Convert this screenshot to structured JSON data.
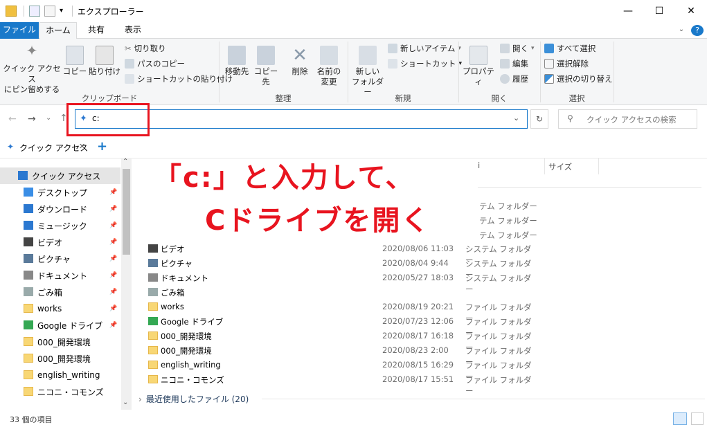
{
  "window": {
    "title": "エクスプローラー",
    "minimize": "—",
    "maximize": "☐",
    "close": "✕",
    "help": "?"
  },
  "tabs": {
    "file": "ファイル",
    "home": "ホーム",
    "share": "共有",
    "view": "表示"
  },
  "ribbon": {
    "clipboard": {
      "label": "クリップボード",
      "pin_quick": "クイック アクセス\nにピン留めする",
      "pin_l1": "クイック アクセス",
      "pin_l2": "にピン留めする",
      "copy": "コピー",
      "paste": "貼り付け",
      "cut": "切り取り",
      "copy_path": "パスのコピー",
      "paste_shortcut": "ショートカットの貼り付け"
    },
    "organize": {
      "label": "整理",
      "move_to": "移動先",
      "copy_to": "コピー先",
      "delete": "削除",
      "rename_l1": "名前の",
      "rename_l2": "変更"
    },
    "new": {
      "label": "新規",
      "new_folder_l1": "新しい",
      "new_folder_l2": "フォルダー",
      "new_item": "新しいアイテム",
      "easy_access": "ショートカット"
    },
    "open": {
      "label": "開く",
      "properties": "プロパティ",
      "open": "開く",
      "edit": "編集",
      "history": "履歴"
    },
    "select": {
      "label": "選択",
      "select_all": "すべて選択",
      "select_none": "選択解除",
      "invert": "選択の切り替え"
    }
  },
  "address": {
    "value": "c:",
    "search_placeholder": "クイック アクセスの検索"
  },
  "folder_tab": {
    "label": "クイック アクセス",
    "close": "✕",
    "add": "+"
  },
  "nav": {
    "items": [
      {
        "label": "クイック アクセス",
        "pinned": false,
        "icon": "star-icon"
      },
      {
        "label": "デスクトップ",
        "pinned": true,
        "icon": "desktop-icon"
      },
      {
        "label": "ダウンロード",
        "pinned": true,
        "icon": "download-icon"
      },
      {
        "label": "ミュージック",
        "pinned": true,
        "icon": "music-icon"
      },
      {
        "label": "ビデオ",
        "pinned": true,
        "icon": "video-icon"
      },
      {
        "label": "ピクチャ",
        "pinned": true,
        "icon": "picture-icon"
      },
      {
        "label": "ドキュメント",
        "pinned": true,
        "icon": "document-icon"
      },
      {
        "label": "ごみ箱",
        "pinned": true,
        "icon": "recycle-bin-icon"
      },
      {
        "label": "works",
        "pinned": true,
        "icon": "folder-icon"
      },
      {
        "label": "Google ドライブ",
        "pinned": true,
        "icon": "google-drive-icon"
      },
      {
        "label": "000_開発環境",
        "pinned": false,
        "icon": "folder-icon"
      },
      {
        "label": "000_開発環境",
        "pinned": false,
        "icon": "folder-icon"
      },
      {
        "label": "english_writing",
        "pinned": false,
        "icon": "folder-icon"
      },
      {
        "label": "ニコニ・コモンズ",
        "pinned": false,
        "icon": "folder-icon"
      }
    ]
  },
  "columns": {
    "name": "i",
    "size": "サイズ"
  },
  "partial_types": [
    "テム フォルダー",
    "テム フォルダー",
    "テム フォルダー"
  ],
  "files": [
    {
      "name": "ビデオ",
      "date": "2020/08/06 11:03",
      "type": "システム フォルダー",
      "icon": "video-icon"
    },
    {
      "name": "ピクチャ",
      "date": "2020/08/04 9:44",
      "type": "システム フォルダー",
      "icon": "picture-icon"
    },
    {
      "name": "ドキュメント",
      "date": "2020/05/27 18:03",
      "type": "システム フォルダー",
      "icon": "document-icon"
    },
    {
      "name": "ごみ箱",
      "date": "",
      "type": "",
      "icon": "recycle-bin-icon"
    },
    {
      "name": "works",
      "date": "2020/08/19 20:21",
      "type": "ファイル フォルダー",
      "icon": "folder-icon"
    },
    {
      "name": "Google ドライブ",
      "date": "2020/07/23 12:06",
      "type": "ファイル フォルダー",
      "icon": "google-drive-icon"
    },
    {
      "name": "000_開発環境",
      "date": "2020/08/17 16:18",
      "type": "ファイル フォルダー",
      "icon": "folder-icon"
    },
    {
      "name": "000_開発環境",
      "date": "2020/08/23 2:00",
      "type": "ファイル フォルダー",
      "icon": "folder-icon"
    },
    {
      "name": "english_writing",
      "date": "2020/08/15 16:29",
      "type": "ファイル フォルダー",
      "icon": "folder-icon"
    },
    {
      "name": "ニコニ・コモンズ",
      "date": "2020/08/17 15:51",
      "type": "ファイル フォルダー",
      "icon": "folder-icon"
    }
  ],
  "recent": {
    "label": "最近使用したファイル (20)"
  },
  "status": {
    "count": "33 個の項目"
  },
  "annotation": {
    "line1": "「c:」と入力して、",
    "line2": "Cドライブを開く",
    "color": "#e8141f"
  }
}
